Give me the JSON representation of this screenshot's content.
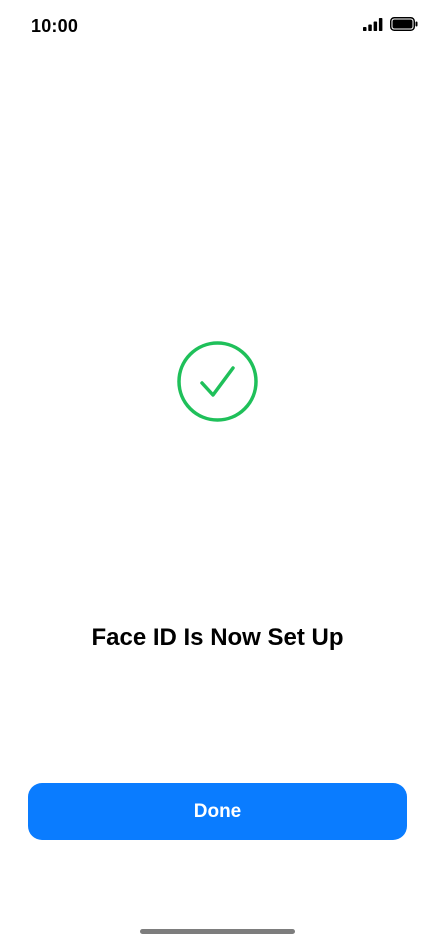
{
  "status_bar": {
    "time": "10:00",
    "icons": [
      "signal-icon",
      "battery-icon"
    ]
  },
  "main": {
    "icon": "checkmark-circle-icon",
    "accent_color": "#1fc05a",
    "title": "Face ID Is Now Set Up"
  },
  "footer": {
    "done_label": "Done",
    "button_color": "#0a7cff"
  }
}
